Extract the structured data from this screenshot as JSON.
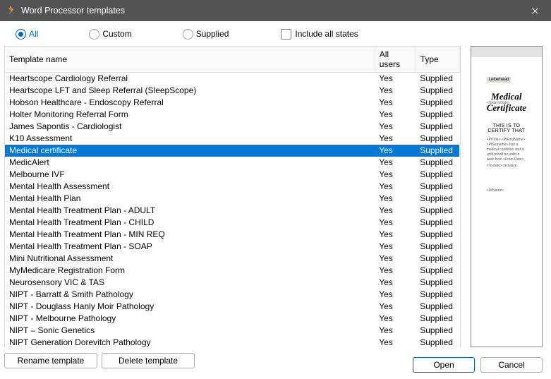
{
  "window": {
    "title": "Word Processor templates"
  },
  "filters": {
    "all_label": "All",
    "custom_label": "Custom",
    "supplied_label": "Supplied",
    "include_all_label": "Include all states",
    "selected": "all"
  },
  "table": {
    "columns": {
      "name": "Template name",
      "users": "All users",
      "type": "Type"
    },
    "rows": [
      {
        "name": "Heartscope Cardiology Referral",
        "users": "Yes",
        "type": "Supplied",
        "selected": false
      },
      {
        "name": "Heartscope LFT and Sleep Referral (SleepScope)",
        "users": "Yes",
        "type": "Supplied",
        "selected": false
      },
      {
        "name": "Hobson Healthcare - Endoscopy Referral",
        "users": "Yes",
        "type": "Supplied",
        "selected": false
      },
      {
        "name": "Holter Monitoring Referral Form",
        "users": "Yes",
        "type": "Supplied",
        "selected": false
      },
      {
        "name": "James Sapontis - Cardiologist",
        "users": "Yes",
        "type": "Supplied",
        "selected": false
      },
      {
        "name": "K10 Assessment",
        "users": "Yes",
        "type": "Supplied",
        "selected": false
      },
      {
        "name": "Medical certificate",
        "users": "Yes",
        "type": "Supplied",
        "selected": true
      },
      {
        "name": "MedicAlert",
        "users": "Yes",
        "type": "Supplied",
        "selected": false
      },
      {
        "name": "Melbourne IVF",
        "users": "Yes",
        "type": "Supplied",
        "selected": false
      },
      {
        "name": "Mental Health Assessment",
        "users": "Yes",
        "type": "Supplied",
        "selected": false
      },
      {
        "name": "Mental Health Plan",
        "users": "Yes",
        "type": "Supplied",
        "selected": false
      },
      {
        "name": "Mental Health Treatment Plan - ADULT",
        "users": "Yes",
        "type": "Supplied",
        "selected": false
      },
      {
        "name": "Mental Health Treatment Plan - CHILD",
        "users": "Yes",
        "type": "Supplied",
        "selected": false
      },
      {
        "name": "Mental Health Treatment Plan - MIN REQ",
        "users": "Yes",
        "type": "Supplied",
        "selected": false
      },
      {
        "name": "Mental Health Treatment Plan - SOAP",
        "users": "Yes",
        "type": "Supplied",
        "selected": false
      },
      {
        "name": "Mini Nutritional Assessment",
        "users": "Yes",
        "type": "Supplied",
        "selected": false
      },
      {
        "name": "MyMedicare Registration Form",
        "users": "Yes",
        "type": "Supplied",
        "selected": false
      },
      {
        "name": "Neurosensory VIC & TAS",
        "users": "Yes",
        "type": "Supplied",
        "selected": false
      },
      {
        "name": "NIPT - Barratt & Smith Pathology",
        "users": "Yes",
        "type": "Supplied",
        "selected": false
      },
      {
        "name": "NIPT - Douglass Hanly Moir Pathology",
        "users": "Yes",
        "type": "Supplied",
        "selected": false
      },
      {
        "name": "NIPT - Melbourne Pathology",
        "users": "Yes",
        "type": "Supplied",
        "selected": false
      },
      {
        "name": "NIPT – Sonic Genetics",
        "users": "Yes",
        "type": "Supplied",
        "selected": false
      },
      {
        "name": "NIPT Generation Dorevitch Pathology",
        "users": "Yes",
        "type": "Supplied",
        "selected": false
      }
    ]
  },
  "buttons": {
    "rename": "Rename template",
    "delete": "Delete template",
    "open": "Open",
    "cancel": "Cancel"
  },
  "preview": {
    "letterhead_btn": "Letterhead",
    "date_field": "<Today'sDate>",
    "title": "Medical Certificate",
    "cert_heading": "THIS IS TO CERTIFY THAT",
    "body_line1": "<PtTitle> <PtFirstName> <PtSurname>    has a medical condition and is unfit to/will be unfit to work from <From Date>",
    "body_line2": "<To date> inclusive.",
    "drname": "<DrName>"
  }
}
